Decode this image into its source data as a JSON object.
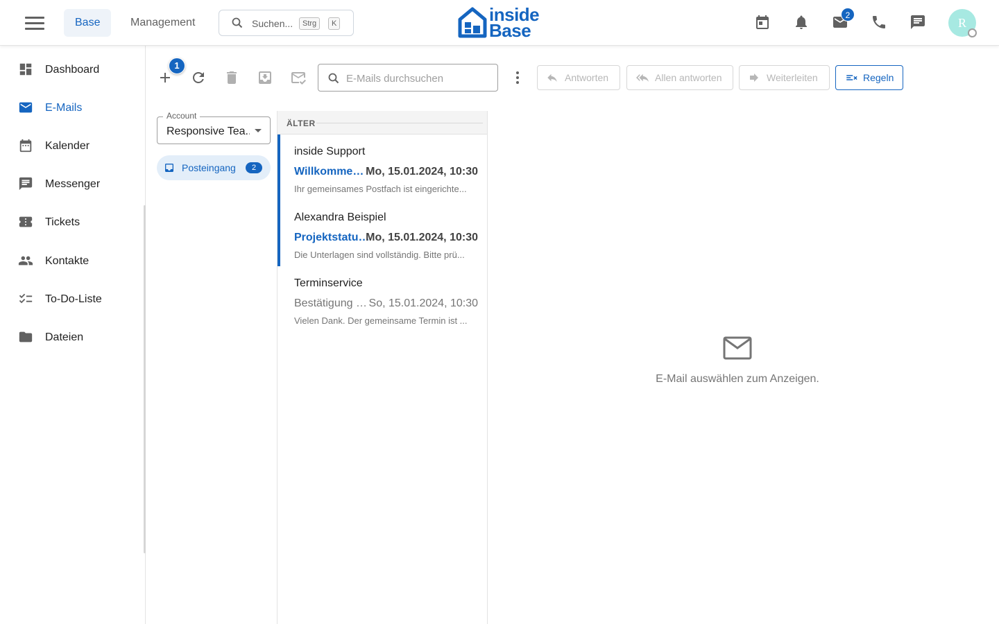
{
  "header": {
    "tabs": [
      {
        "label": "Base",
        "active": true
      },
      {
        "label": "Management",
        "active": false
      }
    ],
    "search": {
      "placeholder": "Suchen...",
      "shortcut_mod": "Strg",
      "shortcut_key": "K"
    },
    "logo": {
      "line1": "inside",
      "line2": "Base"
    },
    "icons": [
      {
        "name": "calendar-icon"
      },
      {
        "name": "bell-icon"
      },
      {
        "name": "mail-icon",
        "badge": "2"
      },
      {
        "name": "phone-icon"
      },
      {
        "name": "chat-icon"
      }
    ],
    "avatar_initial": "R"
  },
  "sidebar": {
    "items": [
      {
        "label": "Dashboard",
        "icon": "dashboard-icon",
        "active": false
      },
      {
        "label": "E-Mails",
        "icon": "mail-icon",
        "active": true
      },
      {
        "label": "Kalender",
        "icon": "calendar-icon",
        "active": false
      },
      {
        "label": "Messenger",
        "icon": "chat-icon",
        "active": false
      },
      {
        "label": "Tickets",
        "icon": "ticket-icon",
        "active": false
      },
      {
        "label": "Kontakte",
        "icon": "contacts-icon",
        "active": false
      },
      {
        "label": "To-Do-Liste",
        "icon": "checklist-icon",
        "active": false
      },
      {
        "label": "Dateien",
        "icon": "folder-icon",
        "active": false
      }
    ]
  },
  "toolbar": {
    "new_badge": "1",
    "search_placeholder": "E-Mails durchsuchen",
    "reply_label": "Antworten",
    "reply_all_label": "Allen antworten",
    "forward_label": "Weiterleiten",
    "rules_label": "Regeln"
  },
  "account": {
    "label": "Account",
    "value": "Responsive Tea..."
  },
  "folders": [
    {
      "label": "Posteingang",
      "count": "2",
      "icon": "inbox-icon"
    }
  ],
  "mail_list": {
    "group_label": "ÄLTER",
    "items": [
      {
        "sender": "inside Support",
        "subject": "Willkommen ...",
        "date": "Mo, 15.01.2024, 10:30",
        "preview": "Ihr gemeinsames Postfach ist eingerichte...",
        "unread": true
      },
      {
        "sender": "Alexandra Beispiel",
        "subject": "Projektstatus...",
        "date": "Mo, 15.01.2024, 10:30",
        "preview": "Die Unterlagen sind vollständig. Bitte prü...",
        "unread": true
      },
      {
        "sender": "Terminservice",
        "subject": "Bestätigung u...",
        "date": "So, 15.01.2024, 10:30",
        "preview": "Vielen Dank. Der gemeinsame Termin ist ...",
        "unread": false
      }
    ]
  },
  "reading_pane": {
    "empty_text": "E-Mail auswählen zum Anzeigen."
  },
  "colors": {
    "accent": "#1565c0",
    "text": "#212121",
    "muted": "#757575",
    "avatar": "#a7e9e2"
  }
}
